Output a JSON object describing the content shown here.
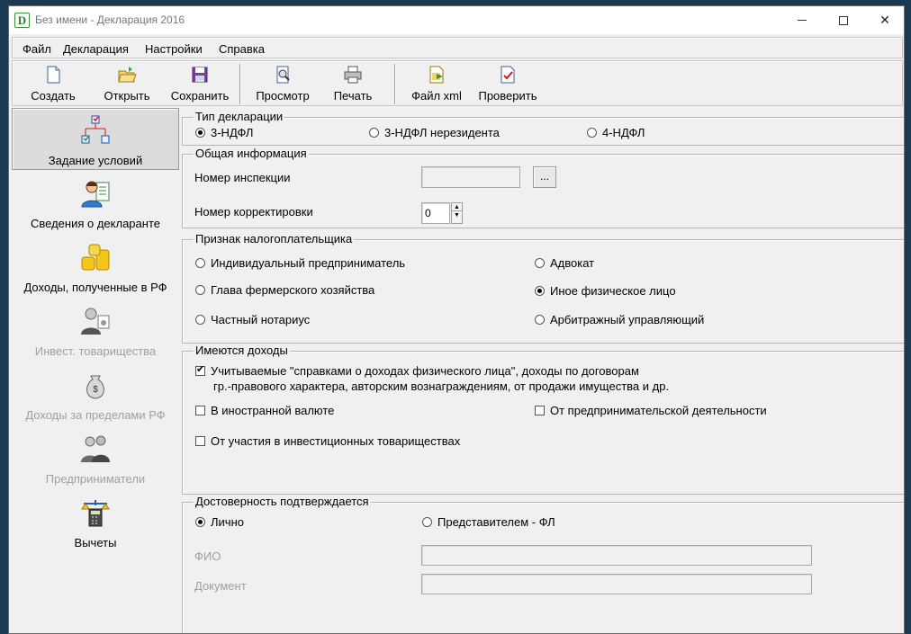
{
  "window": {
    "title": "Без имени - Декларация 2016",
    "icon_letter": "D"
  },
  "menu": [
    "Файл",
    "Декларация",
    "Настройки",
    "Справка"
  ],
  "toolbar": {
    "create": "Создать",
    "open": "Открыть",
    "save": "Сохранить",
    "preview": "Просмотр",
    "print": "Печать",
    "xml": "Файл xml",
    "check": "Проверить"
  },
  "sidebar": {
    "items": [
      {
        "label": "Задание условий",
        "icon": "flowchart-icon",
        "selected": true,
        "enabled": true
      },
      {
        "label": "Сведения о декларанте",
        "icon": "person-document-icon",
        "selected": false,
        "enabled": true
      },
      {
        "label": "Доходы, полученные в РФ",
        "icon": "coins-icon",
        "selected": false,
        "enabled": true
      },
      {
        "label": "Инвест. товарищества",
        "icon": "partners-icon",
        "selected": false,
        "enabled": false
      },
      {
        "label": "Доходы за пределами РФ",
        "icon": "money-bag-icon",
        "selected": false,
        "enabled": false
      },
      {
        "label": "Предприниматели",
        "icon": "businessmen-icon",
        "selected": false,
        "enabled": false
      },
      {
        "label": "Вычеты",
        "icon": "scales-calculator-icon",
        "selected": false,
        "enabled": true
      }
    ]
  },
  "decl_type": {
    "title": "Тип декларации",
    "options": [
      "3-НДФЛ",
      "3-НДФЛ нерезидента",
      "4-НДФЛ"
    ],
    "selected": "3-НДФЛ"
  },
  "general": {
    "title": "Общая информация",
    "inspection_label": "Номер инспекции",
    "inspection_value": "",
    "browse_label": "...",
    "correction_label": "Номер корректировки",
    "correction_value": "0"
  },
  "taxpayer": {
    "title": "Признак налогоплательщика",
    "options": [
      "Индивидуальный предприниматель",
      "Адвокат",
      "Глава фермерского хозяйства",
      "Иное физическое лицо",
      "Частный нотариус",
      "Арбитражный управляющий"
    ],
    "selected": "Иное физическое лицо"
  },
  "income": {
    "title": "Имеются доходы",
    "c1_line1": "Учитываемые \"справками о доходах физического лица\", доходы по договорам",
    "c1_line2": "гр.-правового характера, авторским вознаграждениям, от продажи имущества и др.",
    "c2": "В иностранной валюте",
    "c3": "От предпринимательской деятельности",
    "c4": "От участия в инвестиционных товариществах",
    "checked": [
      true,
      false,
      false,
      false
    ]
  },
  "confirm": {
    "title": "Достоверность подтверждается",
    "opt1": "Лично",
    "opt2": "Представителем - ФЛ",
    "selected": "Лично",
    "fio_label": "ФИО",
    "doc_label": "Документ"
  }
}
